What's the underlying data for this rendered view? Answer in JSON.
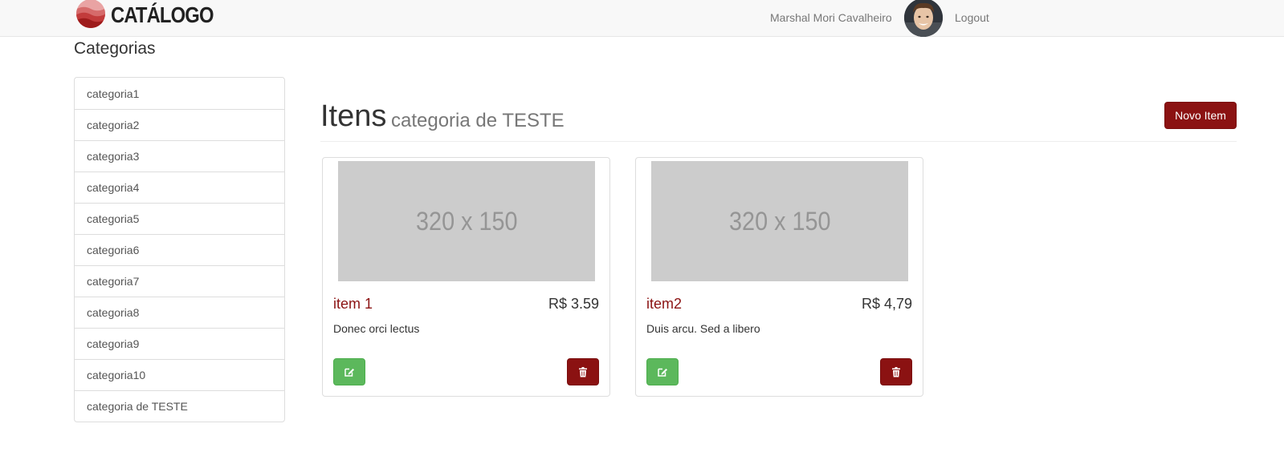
{
  "navbar": {
    "brand": "CATÁLOGO",
    "user_name": "Marshal Mori Cavalheiro",
    "logout_label": "Logout"
  },
  "sidebar": {
    "title": "Categorias",
    "items": [
      {
        "label": "categoria1"
      },
      {
        "label": "categoria2"
      },
      {
        "label": "categoria3"
      },
      {
        "label": "categoria4"
      },
      {
        "label": "categoria5"
      },
      {
        "label": "categoria6"
      },
      {
        "label": "categoria7"
      },
      {
        "label": "categoria8"
      },
      {
        "label": "categoria9"
      },
      {
        "label": "categoria10"
      },
      {
        "label": "categoria de TESTE"
      }
    ]
  },
  "main": {
    "title": "Itens",
    "subtitle": "categoria de TESTE",
    "new_item_label": "Novo Item",
    "items": [
      {
        "image_placeholder": "320 x 150",
        "name": "item 1",
        "price": "R$ 3.59",
        "description": "Donec orci lectus"
      },
      {
        "image_placeholder": "320 x 150",
        "name": "item2",
        "price": "R$ 4,79",
        "description": "Duis arcu. Sed a libero"
      }
    ]
  },
  "colors": {
    "brand_red": "#8b1212",
    "edit_green": "#5cb85c",
    "navbar_bg": "#f8f8f8",
    "placeholder_gray": "#cccccc"
  },
  "icons": {
    "edit": "pencil-square-icon",
    "delete": "trash-icon",
    "logo": "logo-waves-icon"
  }
}
